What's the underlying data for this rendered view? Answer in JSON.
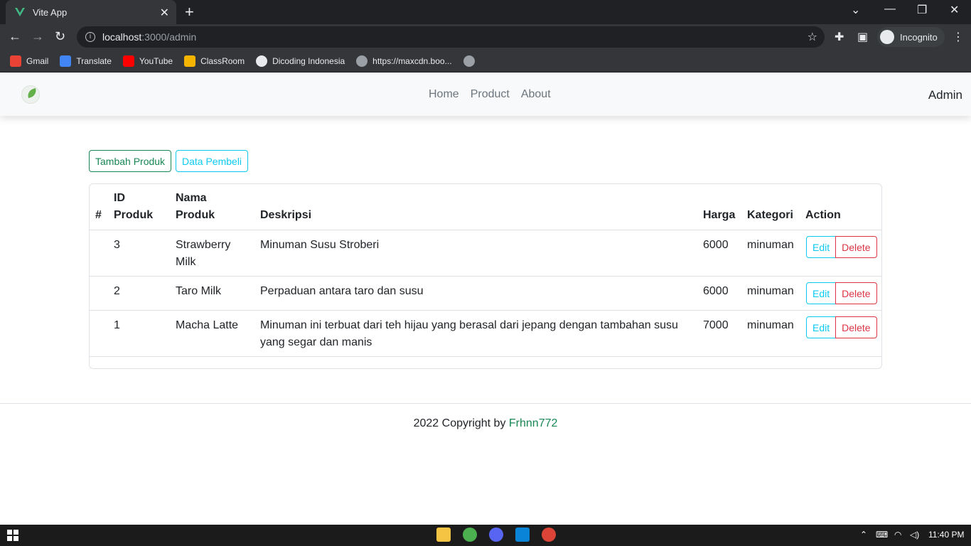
{
  "browser": {
    "tab_title": "Vite App",
    "url_host": "localhost",
    "url_path": ":3000/admin",
    "profile_label": "Incognito",
    "bookmarks": [
      {
        "label": "Gmail",
        "color": "#ea4335"
      },
      {
        "label": "Translate",
        "color": "#4285f4"
      },
      {
        "label": "YouTube",
        "color": "#ff0000"
      },
      {
        "label": "ClassRoom",
        "color": "#f4b400"
      },
      {
        "label": "Dicoding Indonesia",
        "color": "#e8eaed"
      },
      {
        "label": "https://maxcdn.boo...",
        "color": "#9aa0a6"
      }
    ]
  },
  "navbar": {
    "links": [
      "Home",
      "Product",
      "About"
    ],
    "admin_label": "Admin"
  },
  "actions": {
    "add_label": "Tambah Produk",
    "buyers_label": "Data Pembeli"
  },
  "table": {
    "headers": {
      "hash": "#",
      "id_line1": "ID",
      "id_line2": "Produk",
      "nama_line1": "Nama",
      "nama_line2": "Produk",
      "deskripsi": "Deskripsi",
      "harga": "Harga",
      "kategori": "Kategori",
      "action": "Action"
    },
    "edit_label": "Edit",
    "delete_label": "Delete",
    "rows": [
      {
        "id": "3",
        "nama": "Strawberry Milk",
        "deskripsi": "Minuman Susu Stroberi",
        "harga": "6000",
        "kategori": "minuman"
      },
      {
        "id": "2",
        "nama": "Taro Milk",
        "deskripsi": "Perpaduan antara taro dan susu",
        "harga": "6000",
        "kategori": "minuman"
      },
      {
        "id": "1",
        "nama": "Macha Latte",
        "deskripsi": "Minuman ini terbuat dari teh hijau yang berasal dari jepang dengan tambahan susu yang segar dan manis",
        "harga": "7000",
        "kategori": "minuman"
      }
    ]
  },
  "footer": {
    "text": "2022 Copyright by ",
    "author": "Frhnn772"
  },
  "taskbar": {
    "time": "11:40 PM"
  },
  "colors": {
    "success": "#198754",
    "info": "#0dcaf0",
    "danger": "#dc3545"
  }
}
